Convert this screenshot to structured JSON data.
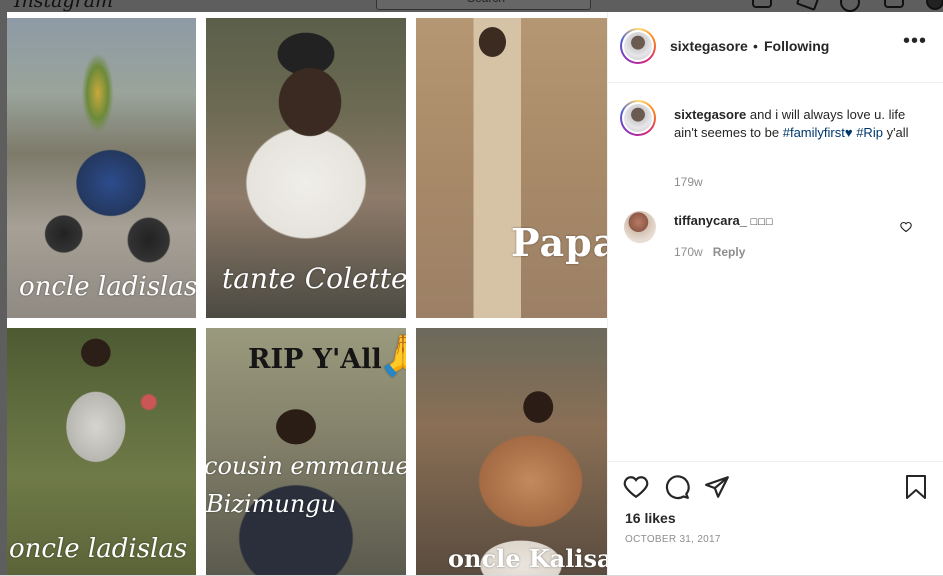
{
  "app": {
    "logo_text": "Instagram",
    "search_placeholder": "Search"
  },
  "post": {
    "username": "sixtegasore",
    "follow_separator": "•",
    "follow_status": "Following",
    "more_label": "•••",
    "caption": {
      "username": "sixtegasore",
      "text_before": "and i will always love u. life ain't seemes to be",
      "tag1": "#familyfirst",
      "heart": "♥",
      "tag2": "#Rip",
      "text_after": "y'all",
      "age": "179w"
    },
    "comments": [
      {
        "username": "tiffanycara_",
        "text": "",
        "age": "170w",
        "reply_label": "Reply"
      }
    ],
    "likes": "16 likes",
    "date": "OCTOBER 31, 2017"
  },
  "photo": {
    "captions": {
      "t1": "oncle ladislas",
      "t2": "tante Colette",
      "t3": "Papa",
      "t4": "oncle ladislas",
      "t5a": "RIP Y'All",
      "t5b": "cousin emmanuel",
      "t5c": "Bizimungu",
      "t6": "oncle Kalisa"
    },
    "emoji": "🙏"
  },
  "colors": {
    "link": "#00376b",
    "meta": "#8e8e8e",
    "text": "#262626"
  }
}
